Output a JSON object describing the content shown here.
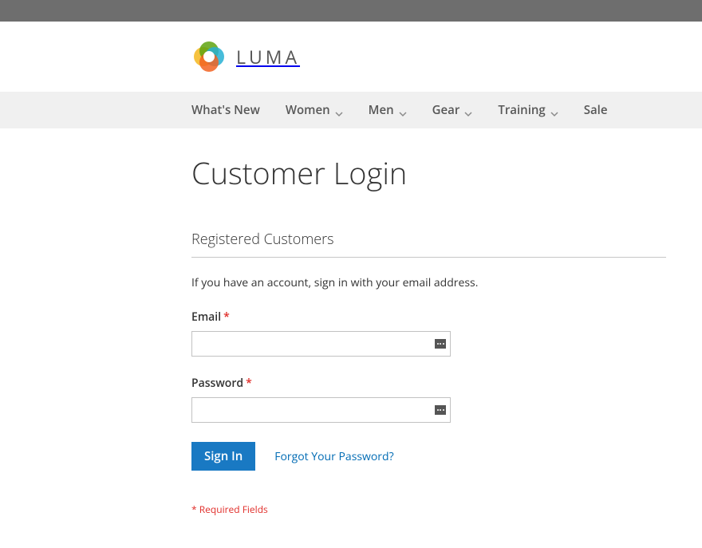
{
  "brand": {
    "name": "LUMA"
  },
  "nav": {
    "items": [
      {
        "label": "What's New",
        "hasDropdown": false
      },
      {
        "label": "Women",
        "hasDropdown": true
      },
      {
        "label": "Men",
        "hasDropdown": true
      },
      {
        "label": "Gear",
        "hasDropdown": true
      },
      {
        "label": "Training",
        "hasDropdown": true
      },
      {
        "label": "Sale",
        "hasDropdown": false
      }
    ]
  },
  "page": {
    "title": "Customer Login"
  },
  "login": {
    "section_title": "Registered Customers",
    "description": "If you have an account, sign in with your email address.",
    "email_label": "Email",
    "password_label": "Password",
    "signin_button": "Sign In",
    "forgot_link": "Forgot Your Password?",
    "required_note": "* Required Fields",
    "email_value": "",
    "password_value": ""
  }
}
